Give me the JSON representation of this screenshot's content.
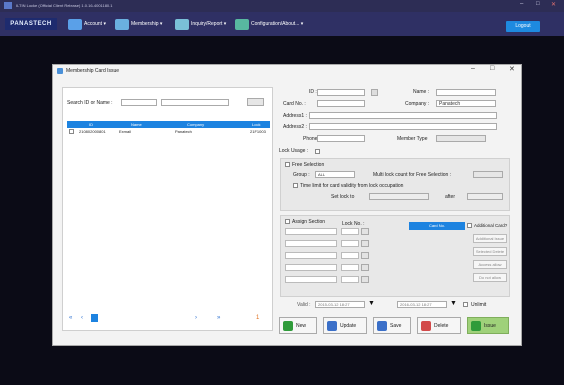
{
  "app": {
    "title": "ILTIN Locke (Official Client Release) 1.0.16-4001180.1",
    "logout_label": "Logout",
    "logo_text": "PANASTECH",
    "menu": [
      {
        "label": "Account ▾"
      },
      {
        "label": "Membership ▾"
      },
      {
        "label": "Inquiry/Report ▾"
      },
      {
        "label": "Configuration/About... ▾"
      }
    ]
  },
  "dialog": {
    "title": "Membership Card Issue",
    "search_label": "Search ID or Name :",
    "search_value": "",
    "grid": {
      "columns": [
        "ID",
        "Name",
        "Company",
        "Lock"
      ],
      "rows": [
        {
          "id": "210802000801",
          "name": "Exmail",
          "company": "Panatech",
          "lock": "21F1003"
        }
      ]
    },
    "pager": {
      "page": "1"
    },
    "form": {
      "id_label": "ID :",
      "name_label": "Name :",
      "cardno_label": "Card No. :",
      "company_label": "Company :",
      "company_value": "Panatech",
      "address1_label": "Address1 :",
      "address2_label": "Address2 :",
      "phone_label": "Phone :",
      "member_type_label": "Member Type",
      "lock_usage_label": "Lock Usage :"
    },
    "free_selection": {
      "title": "Free Selection",
      "group_label": "Group :",
      "group_value": "ALL",
      "multi_lock_label": "Multi lock count for Free Selection :",
      "time_limit_label": "Time limit for card validity from lock occupation",
      "set_lock_label": "Set lock to",
      "after_label": "after"
    },
    "assign_section": {
      "title": "Assign Section",
      "lock_no_label": "Lock No. :",
      "card_no_label": "Card No.",
      "additional_card_label": "Additional Card?",
      "side_buttons": [
        "Additional Issue",
        "Selected Delete",
        "Access allow",
        "Do not allow"
      ]
    },
    "validity": {
      "label": "Valid :",
      "from": "2015-03-12 18:27",
      "to": "2016-03-12 18:27",
      "unlimited_label": "Unlimit"
    },
    "actions": [
      {
        "label": "New",
        "color": "#2f9b3a"
      },
      {
        "label": "Update",
        "color": "#3a6fc8"
      },
      {
        "label": "Save",
        "color": "#3a6fc8"
      },
      {
        "label": "Delete",
        "color": "#d24a4a"
      },
      {
        "label": "Issue",
        "color": "#2f9b3a"
      }
    ]
  },
  "colors": {
    "accent_blue": "#1d83e0",
    "issue_green": "#9fd17a"
  }
}
